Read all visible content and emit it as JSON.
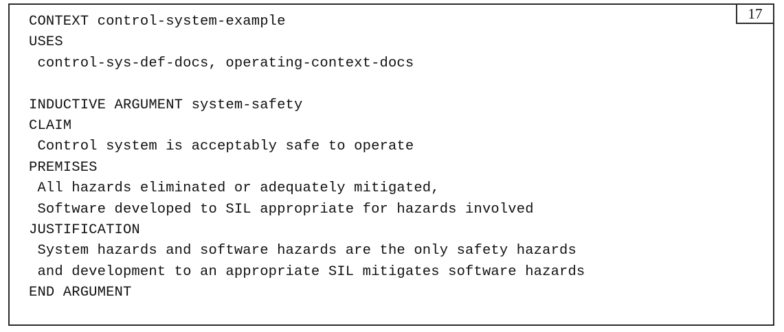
{
  "page_number": "17",
  "context_line": "CONTEXT control-system-example",
  "uses_keyword": "USES",
  "uses_value": " control-sys-def-docs, operating-context-docs",
  "argument_line": "INDUCTIVE ARGUMENT system-safety",
  "claim_keyword": "CLAIM",
  "claim_value": " Control system is acceptably safe to operate",
  "premises_keyword": "PREMISES",
  "premises": [
    " All hazards eliminated or adequately mitigated,",
    " Software developed to SIL appropriate for hazards involved"
  ],
  "justification_keyword": "JUSTIFICATION",
  "justification": [
    " System hazards and software hazards are the only safety hazards",
    " and development to an appropriate SIL mitigates software hazards"
  ],
  "end_line": "END ARGUMENT"
}
